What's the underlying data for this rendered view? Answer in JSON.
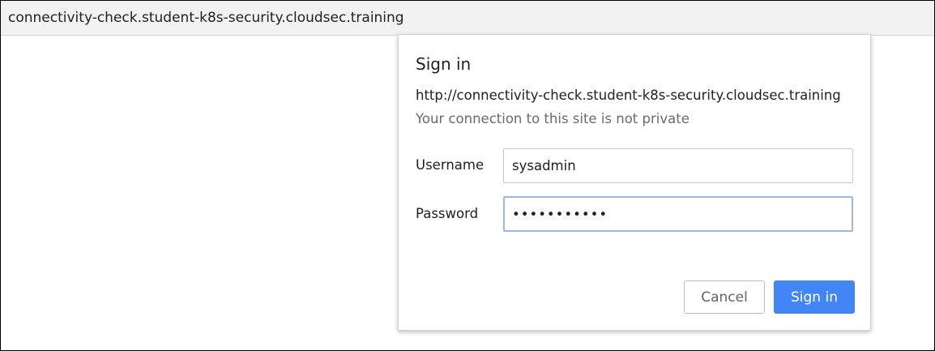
{
  "address_bar": {
    "url": "connectivity-check.student-k8s-security.cloudsec.training"
  },
  "dialog": {
    "title": "Sign in",
    "origin": "http://connectivity-check.student-k8s-security.cloudsec.training",
    "warning": "Your connection to this site is not private",
    "username_label": "Username",
    "username_value": "sysadmin",
    "password_label": "Password",
    "password_value": "sysadmin123",
    "cancel_label": "Cancel",
    "signin_label": "Sign in"
  },
  "colors": {
    "primary_button": "#4285f4",
    "focus_ring": "#9ab8ea",
    "address_bar_bg": "#f2f2f2"
  }
}
